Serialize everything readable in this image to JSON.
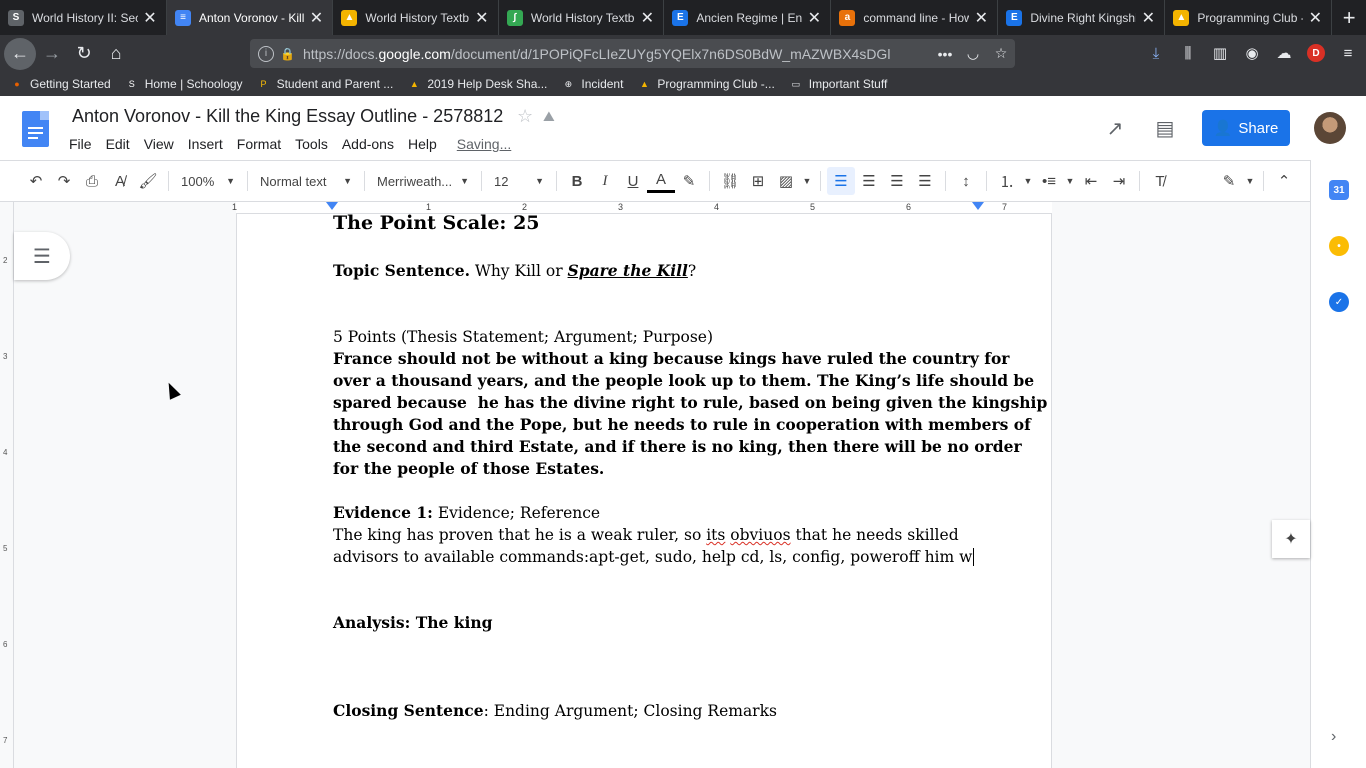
{
  "browser": {
    "tabs": [
      {
        "title": "World History II: Sec",
        "icon": "schoology-icon",
        "color": "#5f6368",
        "glyph": "S",
        "active": false
      },
      {
        "title": "Anton Voronov - Kill",
        "icon": "docs-icon",
        "color": "#4285f4",
        "glyph": "≡",
        "active": true
      },
      {
        "title": "World History Textb",
        "icon": "drive-icon",
        "color": "#f4b400",
        "glyph": "▲",
        "active": false
      },
      {
        "title": "World History Textb",
        "icon": "textbook-icon",
        "color": "#34a853",
        "glyph": "∫",
        "active": false
      },
      {
        "title": "Ancien Regime | Enc",
        "icon": "britannica-icon",
        "color": "#1a73e8",
        "glyph": "E",
        "active": false
      },
      {
        "title": "command line - How",
        "icon": "askubuntu-icon",
        "color": "#e8710a",
        "glyph": "a",
        "active": false
      },
      {
        "title": "Divine Right Kingshi",
        "icon": "britannica-icon",
        "color": "#1a73e8",
        "glyph": "E",
        "active": false
      },
      {
        "title": "Programming Club -",
        "icon": "drive-icon",
        "color": "#f4b400",
        "glyph": "▲",
        "active": false
      }
    ],
    "url_prefix": "https://docs.",
    "url_domain": "google.com",
    "url_rest": "/document/d/1POPiQFcLIeZUYg5YQElx7n6DS0BdW_mAZWBX4sDGl",
    "bookmarks": [
      {
        "label": "Getting Started",
        "icon": "firefox-icon"
      },
      {
        "label": "Home | Schoology",
        "icon": "schoology-icon"
      },
      {
        "label": "Student and Parent ...",
        "icon": "p-icon"
      },
      {
        "label": "2019 Help Desk Sha...",
        "icon": "drive-icon"
      },
      {
        "label": "Incident",
        "icon": "globe-icon"
      },
      {
        "label": "Programming Club -...",
        "icon": "drive-icon"
      },
      {
        "label": "Important Stuff",
        "icon": "folder-icon"
      }
    ],
    "profile_letter": "D"
  },
  "docs": {
    "title": "Anton Voronov - Kill the King Essay Outline - 2578812",
    "menu": [
      "File",
      "Edit",
      "View",
      "Insert",
      "Format",
      "Tools",
      "Add-ons",
      "Help"
    ],
    "saving": "Saving...",
    "share_label": "Share",
    "toolbar": {
      "zoom": "100%",
      "style": "Normal text",
      "font": "Merriweath...",
      "size": "12"
    }
  },
  "ruler": {
    "h_ticks": [
      "1",
      "1",
      "2",
      "3",
      "4",
      "5",
      "6",
      "7"
    ],
    "v_ticks": [
      "2",
      "3",
      "4",
      "5",
      "6",
      "7"
    ]
  },
  "document": {
    "heading": "The Point Scale: 25",
    "topic_label": "Topic Sentence.",
    "topic_rest": " Why Kill or ",
    "topic_em": "Spare the Kill",
    "topic_end": "?",
    "thesis_label": "5 Points (Thesis Statement; Argument; Purpose)",
    "thesis_lines": [
      "France should not be without a king because kings have ruled the country for",
      "over a thousand years, and the people look up to them. The King’s life should be",
      "spared because  he has the divine right to rule, based on being given the kingship",
      "through God and the Pope, but he needs to rule in cooperation with members of",
      "the second and third Estate, and if there is no king, then there will be no order",
      "for the people of those Estates."
    ],
    "evidence_label": "Evidence 1:",
    "evidence_rest": " Evidence; Reference",
    "evidence_line1_a": "The king has proven that he is a weak ruler, so ",
    "evidence_line1_its": "its",
    "evidence_line1_sp": " ",
    "evidence_line1_obv": "obviuos",
    "evidence_line1_b": " that he needs skilled",
    "evidence_line2": "advisors to available commands:apt-get, sudo, help cd, ls, config, poweroff him w",
    "analysis": "Analysis: The king",
    "closing_label": "Closing Sentence",
    "closing_rest": ": Ending Argument; Closing Remarks"
  }
}
